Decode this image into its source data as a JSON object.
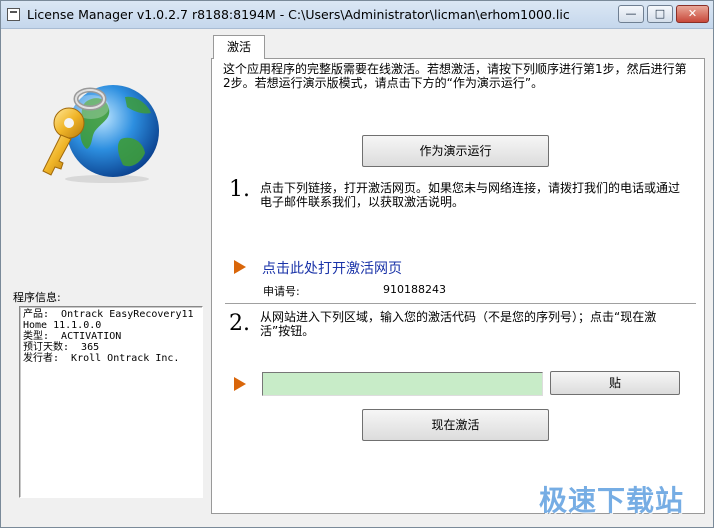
{
  "window": {
    "title": "License Manager v1.0.2.7 r8188:8194M - C:\\Users\\Administrator\\licman\\erhom1000.lic",
    "minimize_glyph": "—",
    "maximize_glyph": "□",
    "close_glyph": "✕"
  },
  "logo": {
    "icon": "key-globe-icon"
  },
  "program_info": {
    "label": "程序信息:",
    "lines": [
      "产品:  Ontrack EasyRecovery11",
      "Home 11.1.0.0",
      "类型:  ACTIVATION",
      "预订天数:  365",
      "发行者:  Kroll Ontrack Inc."
    ]
  },
  "tab": {
    "label": "激活"
  },
  "intro_text": "这个应用程序的完整版需要在线激活。若想激活，请按下列顺序进行第1步，然后进行第2步。若想运行演示版模式，请点击下方的“作为演示运行”。",
  "demo_button": "作为演示运行",
  "step1": {
    "number": "1.",
    "text": "点击下列链接，打开激活网页。如果您未与网络连接，请拨打我们的电话或通过电子邮件联系我们，以获取激活说明。",
    "link": "点击此处打开激活网页",
    "request_label": "申请号:",
    "request_value": "910188243"
  },
  "step2": {
    "number": "2.",
    "text": "从网站进入下列区域，输入您的激活代码（不是您的序列号）；点击“现在激活”按钮。",
    "code_value": "",
    "paste_button": "贴",
    "activate_button": "现在激活"
  },
  "watermark": "极速下载站",
  "colors": {
    "accent_arrow": "#d9660a",
    "link": "#1a33a8",
    "code_field": "#c8ecc8"
  }
}
